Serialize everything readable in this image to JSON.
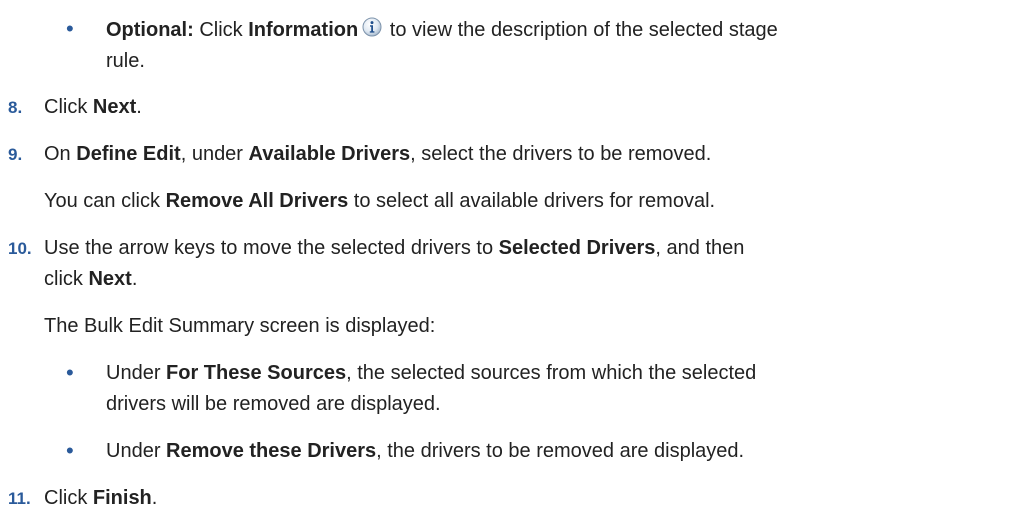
{
  "steps": {
    "optional_bullet": {
      "prefix": "Optional:",
      "t1": " Click ",
      "info_label": "Information",
      "t2": " to view the description of the selected stage",
      "t3": "rule."
    },
    "s8": {
      "num": "8.",
      "t1": "Click ",
      "b1": "Next",
      "t2": "."
    },
    "s9": {
      "num": "9.",
      "t1": "On ",
      "b1": "Define Edit",
      "t2": ", under ",
      "b2": "Available Drivers",
      "t3": ", select the drivers to be removed.",
      "note_t1": "You can click ",
      "note_b1": "Remove All Drivers",
      "note_t2": " to select all available drivers for removal."
    },
    "s10": {
      "num": "10.",
      "t1": "Use the arrow keys to move the selected drivers to ",
      "b1": "Selected Drivers",
      "t2": ", and then",
      "t3": "click ",
      "b2": "Next",
      "t4": ".",
      "summary": "The Bulk Edit Summary screen is displayed:",
      "bullet1": {
        "t1": "Under ",
        "b1": "For These Sources",
        "t2": ", the selected sources from which the selected",
        "t3": "drivers will be removed are displayed."
      },
      "bullet2": {
        "t1": "Under ",
        "b1": "Remove these Drivers",
        "t2": ", the drivers to be removed are displayed."
      }
    },
    "s11": {
      "num": "11.",
      "t1": "Click ",
      "b1": "Finish",
      "t2": "."
    }
  },
  "icons": {
    "info_icon": "information-circle",
    "bullet_glyph": "•"
  },
  "colors": {
    "text": "#222222",
    "accent": "#2a5a9a"
  }
}
